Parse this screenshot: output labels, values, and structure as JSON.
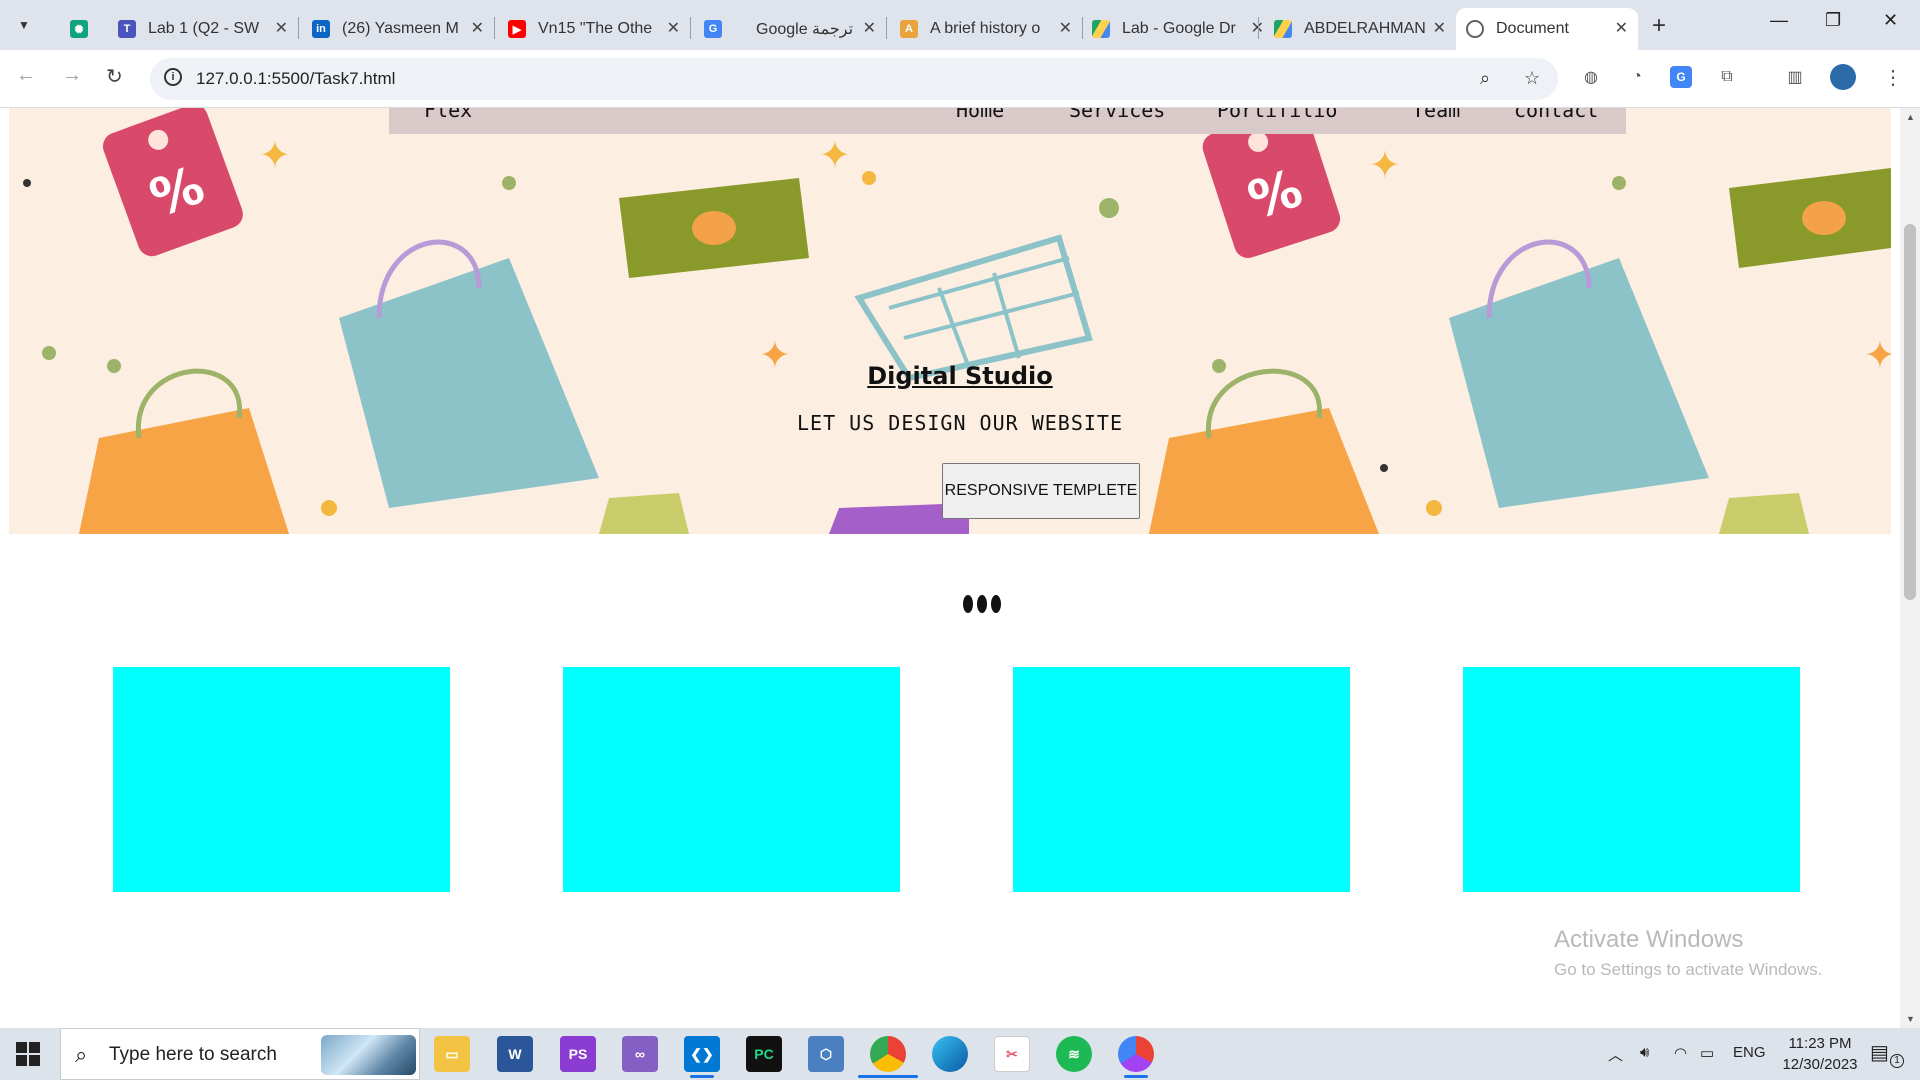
{
  "browser": {
    "tabs": [
      {
        "label": "Lab 1 (Q2 - SW",
        "icon": "teams-icon",
        "color": "#4b53bc"
      },
      {
        "label": "(26) Yasmeen M",
        "icon": "linkedin-icon",
        "color": "#0a66c2"
      },
      {
        "label": "Vn15 \"The Othe",
        "icon": "youtube-icon",
        "color": "#ff0000"
      },
      {
        "label": "Google ترجمة",
        "icon": "google-translate-icon",
        "color": "#4285f4"
      },
      {
        "label": "A brief history o",
        "icon": "article-icon",
        "color": "#e8a33d"
      },
      {
        "label": "Lab - Google Dr",
        "icon": "google-drive-icon",
        "color": "#1fa463"
      },
      {
        "label": "ABDELRAHMAN",
        "icon": "google-drive-icon",
        "color": "#1fa463"
      },
      {
        "label": "Document",
        "icon": "globe-icon",
        "color": "#5f6368",
        "active": true
      }
    ],
    "url": "127.0.0.1:5500/Task7.html"
  },
  "page": {
    "nav": {
      "brand": "Flex",
      "links": [
        "Home",
        "Services",
        "Portifilio",
        "Team",
        "contact"
      ]
    },
    "hero": {
      "title": "Digital Studio",
      "tagline": "LET US DESIGN OUR WEBSITE",
      "button": "RESPONSIVE TEMPLETE"
    },
    "cards_count": 4,
    "card_color": "#00ffff"
  },
  "watermark": {
    "title": "Activate Windows",
    "subtitle": "Go to Settings to activate Windows."
  },
  "taskbar": {
    "search_placeholder": "Type here to search",
    "apps": [
      "file-explorer-icon",
      "word-icon",
      "phpstorm-icon",
      "visual-studio-icon",
      "vscode-icon",
      "pycharm-icon",
      "virtualbox-icon",
      "chrome-icon",
      "edge-icon",
      "snipping-tool-icon",
      "spotify-icon",
      "chrome-canary-icon"
    ],
    "tray": {
      "language": "ENG",
      "time": "11:23 PM",
      "date": "12/30/2023",
      "notifications": "1"
    }
  }
}
